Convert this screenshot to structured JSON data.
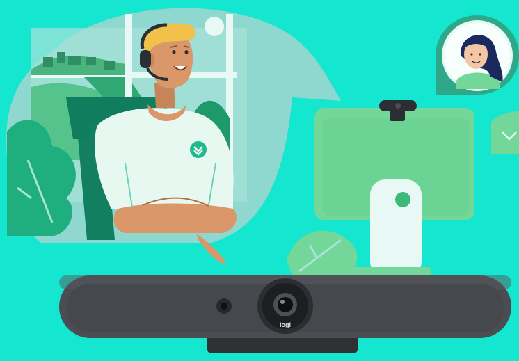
{
  "scene": {
    "description_colors": {
      "background": "#14E6CF",
      "bubble": "#8ED8CF",
      "monitor": "#73D79A",
      "device_body": "#4A4D52",
      "skin": "#D9976A",
      "hair": "#F1C14A",
      "shirt": "#E7F8F1",
      "accent_green": "#1FB98E"
    }
  },
  "device": {
    "brand": "logi"
  },
  "icons": {
    "chat_bubble": "speech-bubble-icon",
    "shirt_logo": "chevron-down-badge-icon",
    "side_badge": "chevron-down-icon",
    "avatar": "user-avatar-icon",
    "camera": "webcam-icon"
  }
}
